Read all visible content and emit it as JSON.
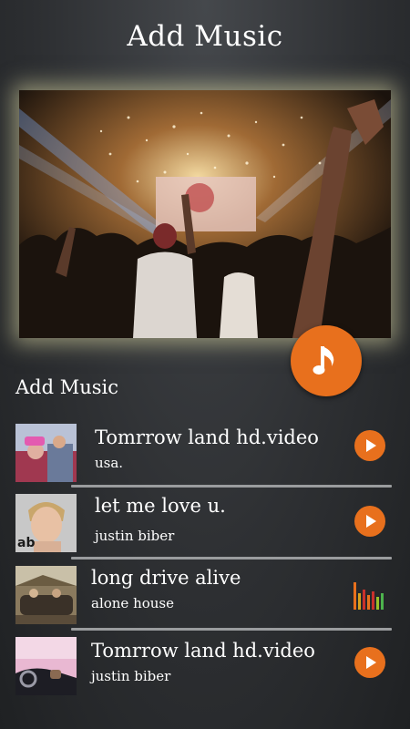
{
  "header": {
    "title": "Add Music"
  },
  "fab": {
    "icon": "music-note-icon"
  },
  "section": {
    "title": "Add Music"
  },
  "tracks": [
    {
      "title": "Tomrrow land hd.video",
      "subtitle": "usa.",
      "action": "play-icon"
    },
    {
      "title": "let me love u.",
      "subtitle": "justin biber",
      "action": "play-icon"
    },
    {
      "title": "long drive alive",
      "subtitle": "alone house",
      "action": "equalizer-icon"
    },
    {
      "title": "Tomrrow land hd.video",
      "subtitle": "justin biber",
      "action": "play-icon"
    }
  ],
  "colors": {
    "accent": "#e8701d",
    "background": "#2e3033",
    "divider": "#9a9c9e"
  }
}
